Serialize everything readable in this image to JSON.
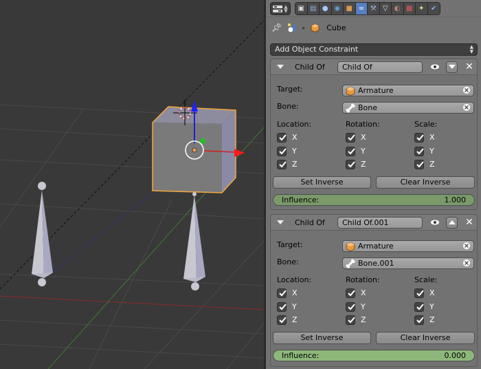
{
  "header": {
    "editor_type": "properties-editor-icon",
    "tabs": [
      {
        "name": "render",
        "icon": "camera-icon",
        "active": false
      },
      {
        "name": "render-layers",
        "icon": "render-layers-icon",
        "active": false
      },
      {
        "name": "scene",
        "icon": "scene-icon",
        "active": false
      },
      {
        "name": "world",
        "icon": "world-icon",
        "active": false
      },
      {
        "name": "object",
        "icon": "cube-icon",
        "active": false
      },
      {
        "name": "constraints",
        "icon": "link-icon",
        "active": true
      },
      {
        "name": "modifiers",
        "icon": "wrench-icon",
        "active": false
      },
      {
        "name": "data",
        "icon": "mesh-data-icon",
        "active": false
      },
      {
        "name": "material",
        "icon": "material-icon",
        "active": false
      },
      {
        "name": "texture",
        "icon": "texture-icon",
        "active": false
      },
      {
        "name": "particles",
        "icon": "particles-icon",
        "active": false
      },
      {
        "name": "physics",
        "icon": "physics-icon",
        "active": false
      }
    ]
  },
  "breadcrumb": {
    "object_name": "Cube"
  },
  "add_constraint": {
    "label": "Add Object Constraint"
  },
  "constraints": [
    {
      "type_label": "Child Of",
      "name": "Child Of",
      "move_direction": "down",
      "target_label": "Target:",
      "target_value": "Armature",
      "bone_label": "Bone:",
      "bone_value": "Bone",
      "location_label": "Location:",
      "rotation_label": "Rotation:",
      "scale_label": "Scale:",
      "axes": [
        "X",
        "Y",
        "Z"
      ],
      "location": [
        true,
        true,
        true
      ],
      "rotation": [
        true,
        true,
        true
      ],
      "scale": [
        true,
        true,
        true
      ],
      "set_inverse_label": "Set Inverse",
      "clear_inverse_label": "Clear Inverse",
      "influence_label": "Influence:",
      "influence_value": "1.000",
      "influence": 1.0
    },
    {
      "type_label": "Child Of",
      "name": "Child Of.001",
      "move_direction": "up",
      "target_label": "Target:",
      "target_value": "Armature",
      "bone_label": "Bone:",
      "bone_value": "Bone.001",
      "location_label": "Location:",
      "rotation_label": "Rotation:",
      "scale_label": "Scale:",
      "axes": [
        "X",
        "Y",
        "Z"
      ],
      "location": [
        true,
        true,
        true
      ],
      "rotation": [
        true,
        true,
        true
      ],
      "scale": [
        true,
        true,
        true
      ],
      "set_inverse_label": "Set Inverse",
      "clear_inverse_label": "Clear Inverse",
      "influence_label": "Influence:",
      "influence_value": "0.000",
      "influence": 0.0
    }
  ],
  "colors": {
    "viewport_bg": "#393939",
    "panel_bg": "#727272",
    "active_tab": "#5680c2",
    "selection_outline": "#f5a83c",
    "influence_fill": "#7a9a6a",
    "influence_fill_hover": "#8db77a"
  }
}
